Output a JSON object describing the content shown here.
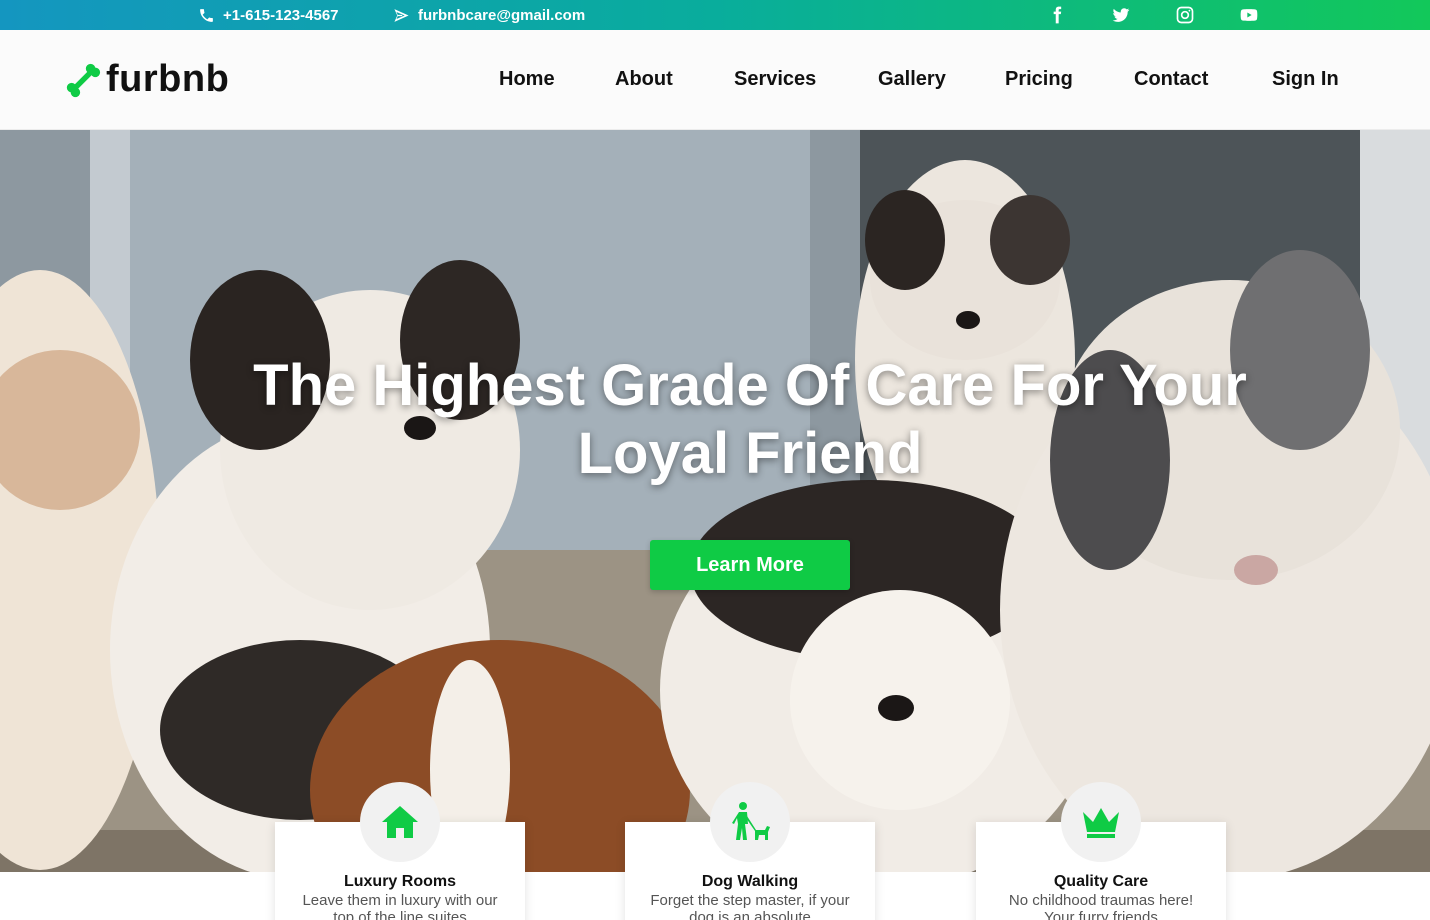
{
  "topbar": {
    "phone": "+1-615-123-4567",
    "email": "furbnbcare@gmail.com",
    "socials": [
      "facebook-icon",
      "twitter-icon",
      "instagram-icon",
      "youtube-icon"
    ]
  },
  "brand": {
    "name": "furbnb",
    "logo_icon": "bone-icon",
    "accent": "#0fcb45"
  },
  "nav": {
    "items": [
      "Home",
      "About",
      "Services",
      "Gallery",
      "Pricing",
      "Contact",
      "Sign In"
    ]
  },
  "hero": {
    "title": "The Highest Grade Of Care For Your Loyal Friend",
    "button": "Learn More"
  },
  "features": [
    {
      "icon": "house-icon",
      "title": "Luxury Rooms",
      "text": "Leave them in luxury with our top of the line suites"
    },
    {
      "icon": "dog-walking-icon",
      "title": "Dog Walking",
      "text": "Forget the step master, if your dog is an absolute"
    },
    {
      "icon": "crown-icon",
      "title": "Quality Care",
      "text": "No childhood traumas here! Your furry friends"
    }
  ]
}
